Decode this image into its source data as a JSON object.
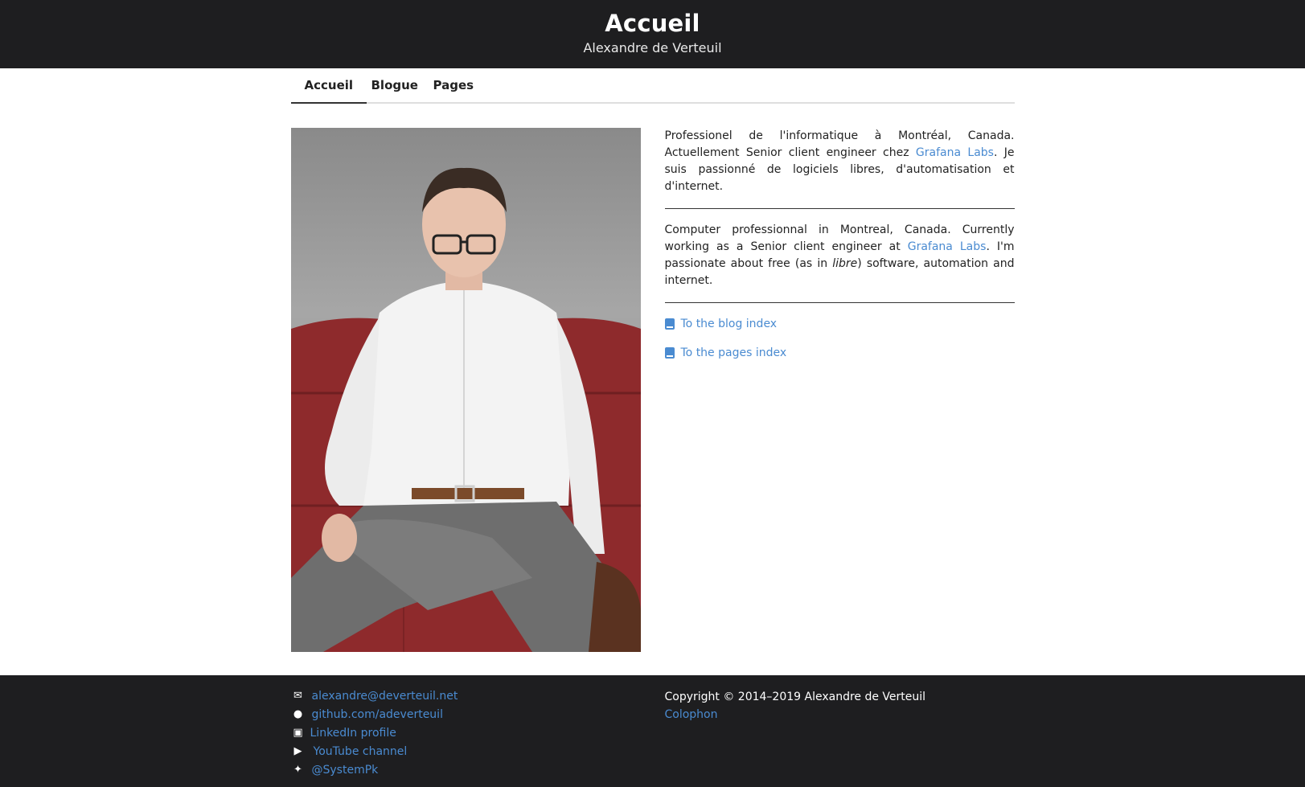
{
  "header": {
    "title": "Accueil",
    "subtitle": "Alexandre de Verteuil"
  },
  "nav": {
    "tabs": [
      {
        "label": "Accueil",
        "active": true
      },
      {
        "label": "Blogue",
        "active": false
      },
      {
        "label": "Pages",
        "active": false
      }
    ]
  },
  "intro_fr": {
    "before": "Professionel de l'informatique à Montréal, Canada. Actuellement Senior client engineer chez ",
    "link": "Grafana Labs",
    "after": ". Je suis passionné de logiciels libres, d'automatisation et d'internet."
  },
  "intro_en": {
    "before": "Computer professionnal in Montreal, Canada. Currently working as a Senior client engineer at ",
    "link": "Grafana Labs",
    "middle": ". I'm passionate about free (as in ",
    "em": "libre",
    "after": ") software, automation and internet."
  },
  "index_links": [
    {
      "label": "To the blog index",
      "icon": "book-icon"
    },
    {
      "label": "To the pages index",
      "icon": "book-icon"
    }
  ],
  "footer": {
    "social": [
      {
        "label": "alexandre@deverteuil.net",
        "icon": "envelope-icon"
      },
      {
        "label": "github.com/adeverteuil",
        "icon": "github-icon"
      },
      {
        "label": "LinkedIn profile",
        "icon": "linkedin-icon"
      },
      {
        "label": "YouTube channel",
        "icon": "youtube-icon"
      },
      {
        "label": "@SystemPk",
        "icon": "twitter-icon"
      }
    ],
    "copyright": "Copyright © 2014–2019 Alexandre de Verteuil",
    "colophon": "Colophon"
  },
  "colors": {
    "header_bg": "#1e1e20",
    "link": "#4a8bd1",
    "sofa": "#8e2a2c"
  }
}
